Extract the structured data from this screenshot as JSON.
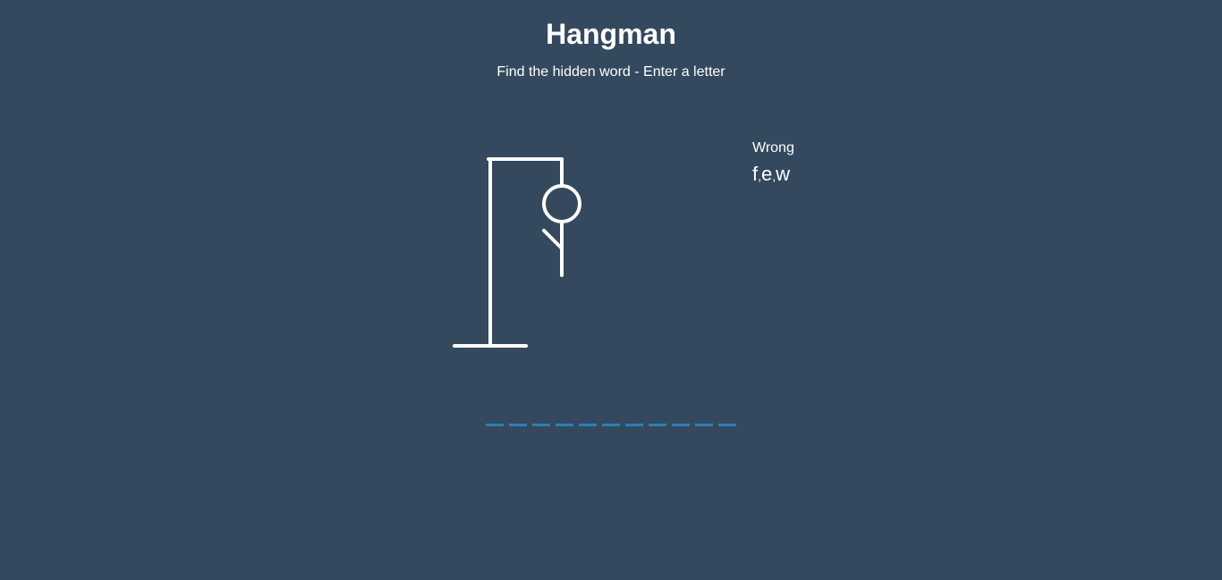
{
  "header": {
    "title": "Hangman",
    "subtitle": "Find the hidden word - Enter a letter"
  },
  "wrong": {
    "label": "Wrong",
    "letters": [
      "f",
      "e",
      "w"
    ],
    "separator": ","
  },
  "hangman": {
    "parts_drawn": [
      "gallows",
      "head",
      "body",
      "left-arm"
    ],
    "stroke_color": "#ffffff"
  },
  "word": {
    "letters": [
      "",
      "",
      "",
      "",
      "",
      "",
      "",
      "",
      "",
      "",
      ""
    ],
    "underline_color": "#2980b9"
  },
  "colors": {
    "background": "#34495e",
    "text": "#ffffff",
    "accent": "#2980b9"
  }
}
